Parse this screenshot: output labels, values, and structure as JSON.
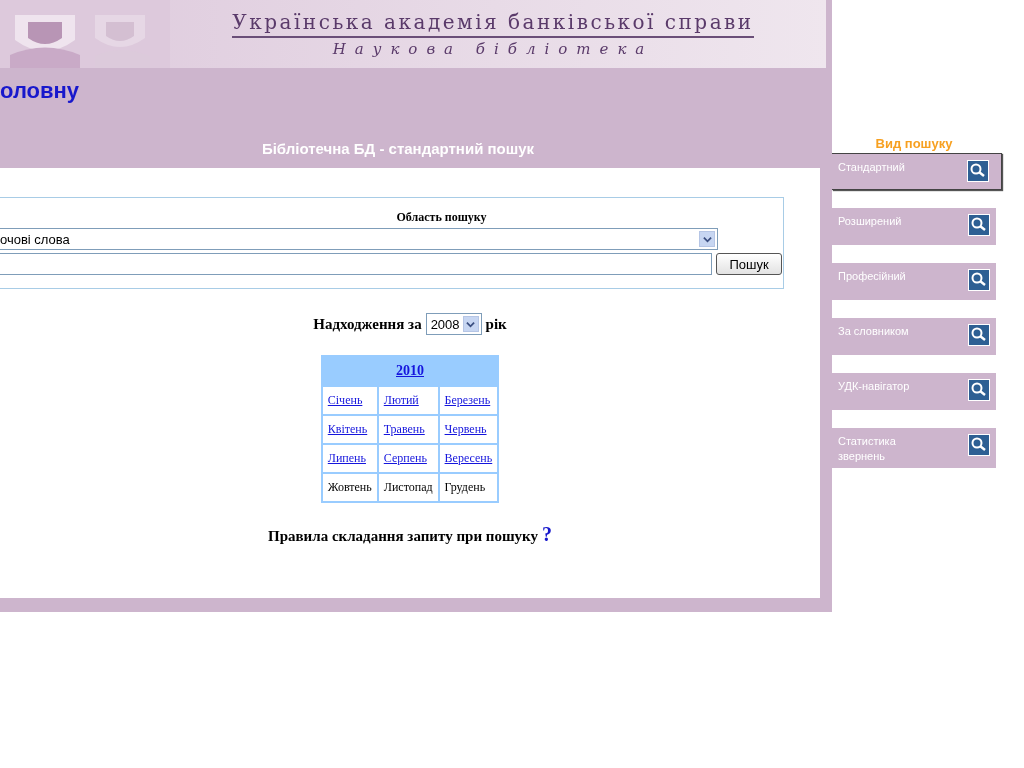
{
  "header": {
    "title": "Українська академія банківської справи",
    "subtitle": "Наукова бібліотека"
  },
  "home_link": "оловну",
  "section_title": "Бібліотечна БД - стандартний пошук",
  "search": {
    "legend": "Область пошуку",
    "area_value": "очові слова",
    "button": "Пошук"
  },
  "arrivals": {
    "label_before": "Надходження за",
    "year": "2008",
    "label_after": "рік",
    "table_year": "2010",
    "months": [
      {
        "label": "Січень",
        "link": true
      },
      {
        "label": "Лютий",
        "link": true
      },
      {
        "label": "Березень",
        "link": true
      },
      {
        "label": "Квітень",
        "link": true
      },
      {
        "label": "Травень",
        "link": true
      },
      {
        "label": "Червень",
        "link": true
      },
      {
        "label": "Липень",
        "link": true
      },
      {
        "label": "Серпень",
        "link": true
      },
      {
        "label": "Вересень",
        "link": true
      },
      {
        "label": "Жовтень",
        "link": false
      },
      {
        "label": "Листопад",
        "link": false
      },
      {
        "label": "Грудень",
        "link": false
      }
    ]
  },
  "rules": {
    "text": "Правила складання запиту при пошуку",
    "help": "?"
  },
  "sidebar": {
    "title": "Вид пошуку",
    "items": [
      {
        "label": "Стандартний",
        "selected": true
      },
      {
        "label": "Розширений",
        "selected": false
      },
      {
        "label": "Професійний",
        "selected": false
      },
      {
        "label": "За словником",
        "selected": false
      },
      {
        "label": "УДК-навігатор",
        "selected": false
      },
      {
        "label": "Статистика звернень",
        "selected": false
      }
    ]
  }
}
